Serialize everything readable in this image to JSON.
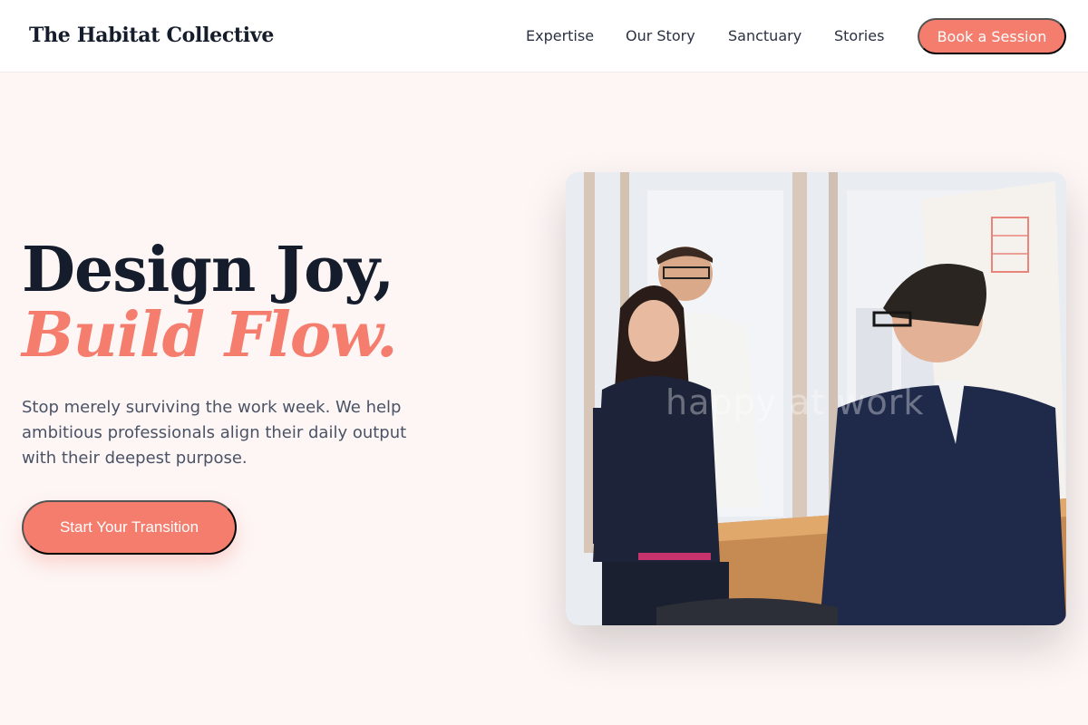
{
  "header": {
    "logo": "The Habitat Collective",
    "nav": [
      "Expertise",
      "Our Story",
      "Sanctuary",
      "Stories"
    ],
    "cta_label": "Book a Session"
  },
  "hero": {
    "headline_line1": "Design Joy,",
    "headline_line2": "Build Flow.",
    "subtext": "Stop merely surviving the work week. We help ambitious professionals align their daily output with their deepest purpose.",
    "cta_label": "Start Your Transition",
    "image_watermark": "happy at work"
  },
  "colors": {
    "accent": "#f47d6e",
    "background": "#fdf6f5",
    "heading": "#151c2b",
    "body_text": "#4a5366"
  }
}
